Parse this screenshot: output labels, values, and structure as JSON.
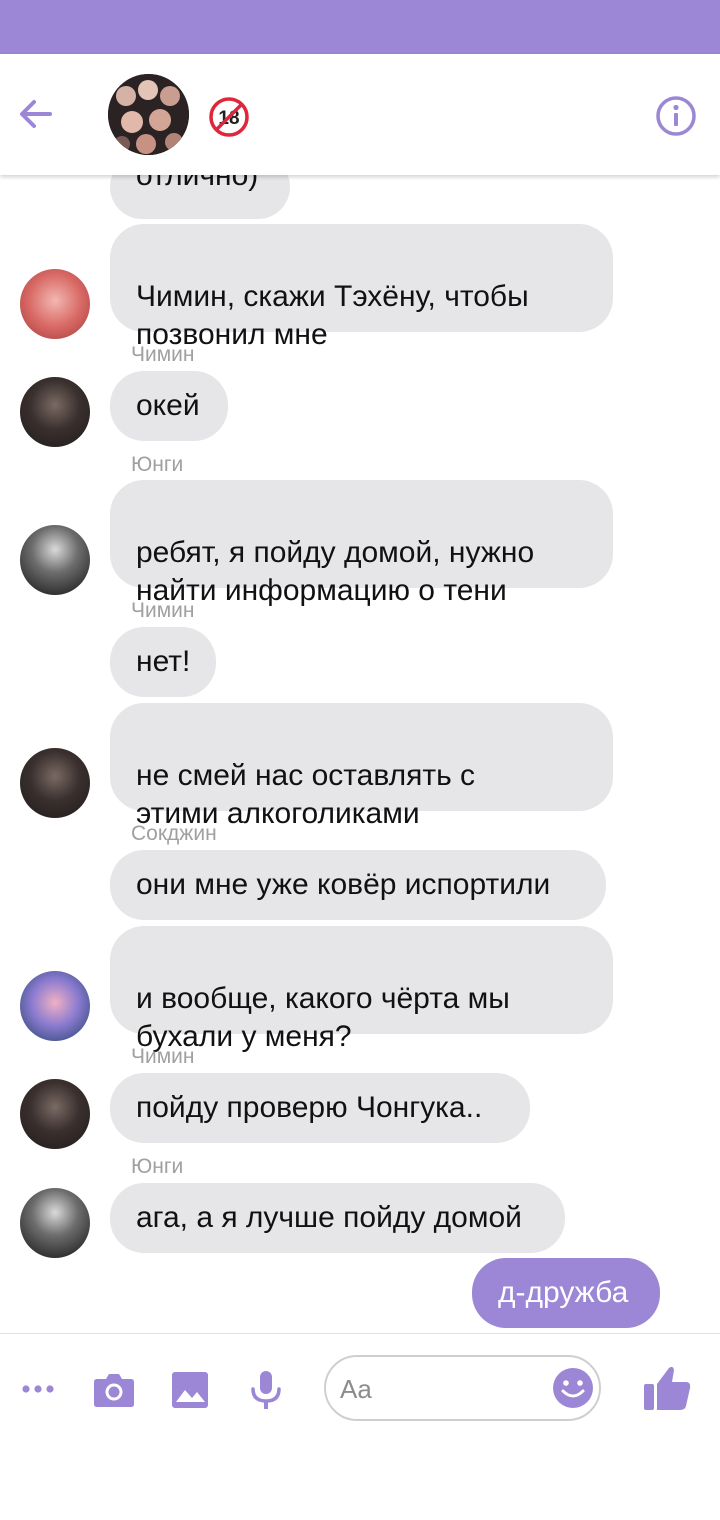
{
  "header": {
    "age_badge": "18"
  },
  "messages": [
    {
      "sender": "",
      "text": "отлично)",
      "avatar": ""
    },
    {
      "sender": "",
      "text": "Чимин, скажи Тэхёну, чтобы\nпозвонил мне",
      "avatar": "pink"
    },
    {
      "sender": "Чимин",
      "text": "окей",
      "avatar": "dark"
    },
    {
      "sender": "Юнги",
      "text": "ребят, я пойду домой, нужно\nнайти информацию о тени",
      "avatar": "black"
    },
    {
      "sender": "Чимин",
      "text": "нет!",
      "avatar": ""
    },
    {
      "sender": "",
      "text": "не смей нас оставлять с\nэтими алкоголиками",
      "avatar": "dark"
    },
    {
      "sender": "Сокджин",
      "text": "они мне уже ковёр испортили",
      "avatar": ""
    },
    {
      "sender": "",
      "text": "и вообще, какого чёрта мы\nбухали у меня?",
      "avatar": "blue"
    },
    {
      "sender": "Чимин",
      "text": "пойду проверю Чонгука..",
      "avatar": "dark"
    },
    {
      "sender": "Юнги",
      "text": "ага, а я лучше пойду домой",
      "avatar": "black"
    },
    {
      "sender": "",
      "text": "д-дружба",
      "avatar": "",
      "mine": true
    }
  ],
  "composer": {
    "placeholder": "Aa"
  },
  "colors": {
    "accent": "#9b87d6",
    "bubble_incoming": "#e6e6e8",
    "sender_name": "#a0a0a0"
  },
  "icons": [
    "back-arrow-icon",
    "info-icon",
    "more-icon",
    "camera-icon",
    "image-icon",
    "microphone-icon",
    "emoji-icon",
    "thumbs-up-icon"
  ]
}
